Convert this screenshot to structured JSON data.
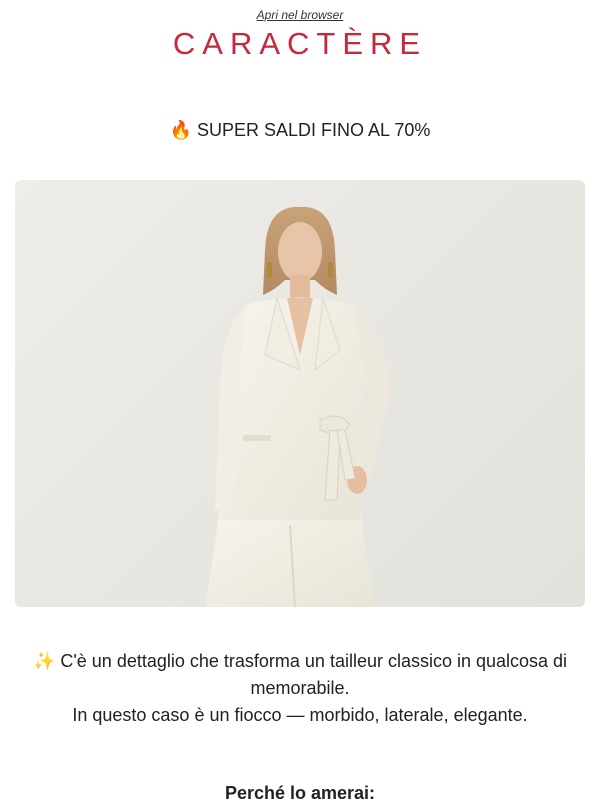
{
  "header": {
    "browser_link": "Apri nel browser",
    "logo": "CARACTÈRE",
    "brand_color": "#c8283a"
  },
  "promo": {
    "icon": "fire-icon",
    "text": "🔥 SUPER SALDI FINO AL 70%"
  },
  "hero": {
    "image": "woman-in-white-wrap-blazer-suit-photo"
  },
  "body": {
    "line1": "✨ C'è un dettaglio che trasforma un tailleur classico in qualcosa di memorabile.",
    "line2": "In questo caso è un fiocco — morbido, laterale, elegante."
  },
  "section": {
    "title": "Perché lo amerai:"
  }
}
